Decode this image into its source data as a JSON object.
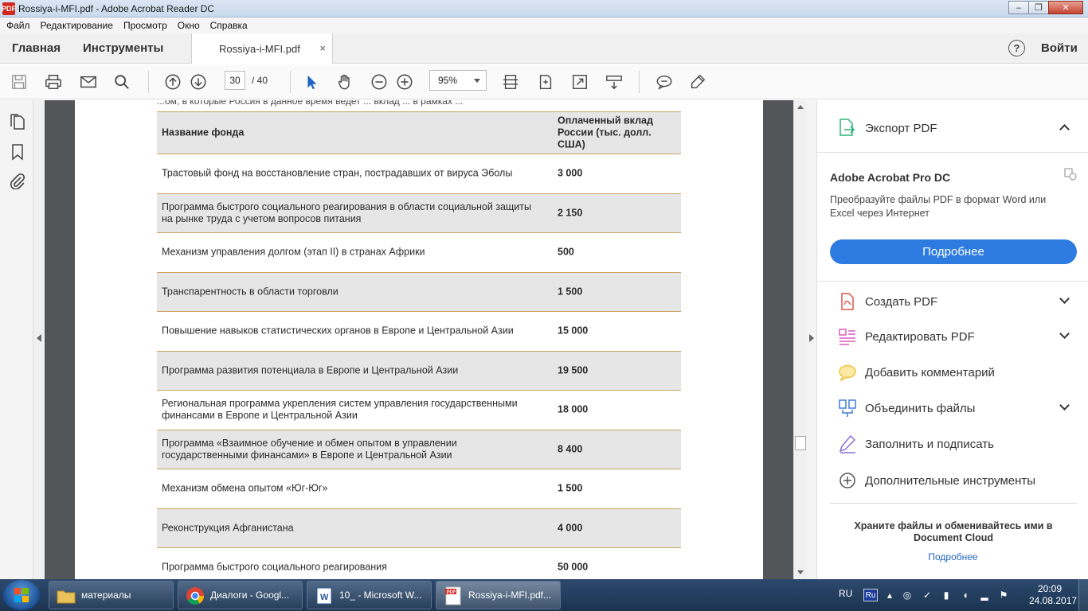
{
  "window": {
    "title": "Rossiya-i-MFI.pdf - Adobe Acrobat Reader DC",
    "app_icon": "PDF",
    "controls": [
      "‒",
      "❐",
      "✕"
    ]
  },
  "menu": [
    "Файл",
    "Редактирование",
    "Просмотр",
    "Окно",
    "Справка"
  ],
  "tabs": {
    "home": "Главная",
    "tools": "Инструменты",
    "document": "Rossiya-i-MFI.pdf",
    "close": "×",
    "help": "?",
    "login": "Войти"
  },
  "toolbar": {
    "page_current": "30",
    "page_total": "/  40",
    "zoom": "95%"
  },
  "document": {
    "cut_line": "...ом, в которые Россия в данное время ведет ... вклад ... в рамках ...",
    "table": {
      "header": {
        "name": "Название фонда",
        "value": "Оплаченный вклад России (тыс. долл. США)"
      },
      "rows": [
        {
          "name": "Трастовый фонд на восстановление стран, пострадавших от вируса Эболы",
          "value": "3 000"
        },
        {
          "name": "Программа быстрого социального реагирования в области социальной защиты на рынке труда с учетом вопросов питания",
          "value": "2 150"
        },
        {
          "name": "Механизм управления долгом (этап II) в странах Африки",
          "value": "500"
        },
        {
          "name": "Транспарентность в области торговли",
          "value": "1 500"
        },
        {
          "name": "Повышение навыков статистических органов в Европе и Центральной Азии",
          "value": "15 000"
        },
        {
          "name": "Программа развития потенциала в Европе и Центральной Азии",
          "value": "19 500"
        },
        {
          "name": "Региональная программа укрепления систем управления государственными финансами в Европе и Центральной Азии",
          "value": "18 000"
        },
        {
          "name": "Программа «Взаимное обучение и обмен опытом в управлении государственными финансами» в Европе и Центральной Азии",
          "value": "8 400"
        },
        {
          "name": "Механизм обмена опытом «Юг-Юг»",
          "value": "1 500"
        },
        {
          "name": "Реконструкция Афганистана",
          "value": "4 000"
        },
        {
          "name": "Программа быстрого социального реагирования",
          "value": "50 000"
        }
      ]
    }
  },
  "right_pane": {
    "export_label": "Экспорт PDF",
    "pro_title": "Adobe Acrobat Pro DC",
    "pro_desc": "Преобразуйте файлы PDF в формат Word или Excel через Интернет",
    "pro_button": "Подробнее",
    "tools": [
      {
        "label": "Создать PDF",
        "icon": "create-pdf-icon",
        "color": "#e2574c"
      },
      {
        "label": "Редактировать PDF",
        "icon": "edit-pdf-icon",
        "color": "#d95cc1"
      },
      {
        "label": "Добавить комментарий",
        "icon": "comment-icon",
        "color": "#f0c23a"
      },
      {
        "label": "Объединить файлы",
        "icon": "combine-files-icon",
        "color": "#3f7fd6"
      },
      {
        "label": "Заполнить и подписать",
        "icon": "fill-sign-icon",
        "color": "#8a6fd1"
      },
      {
        "label": "Дополнительные инструменты",
        "icon": "more-tools-icon",
        "color": "#555555"
      }
    ],
    "cloud_text": "Храните файлы и обменивайтесь ими в Document Cloud",
    "cloud_link": "Подробнее"
  },
  "taskbar": {
    "items": [
      {
        "label": "материалы",
        "icon": "folder-icon"
      },
      {
        "label": "Диалоги - Googl...",
        "icon": "chrome-icon"
      },
      {
        "label": "10_ - Microsoft W...",
        "icon": "word-icon"
      },
      {
        "label": "Rossiya-i-MFI.pdf...",
        "icon": "pdf-icon"
      }
    ],
    "lang": "RU",
    "lang_badge": "Ru",
    "time": "20:09",
    "date": "24.08.2017"
  },
  "colors": {
    "accent": "#2d7be0",
    "rule": "#c9a360",
    "row_shade": "#e6e6e6",
    "doc_bg": "#525659"
  }
}
